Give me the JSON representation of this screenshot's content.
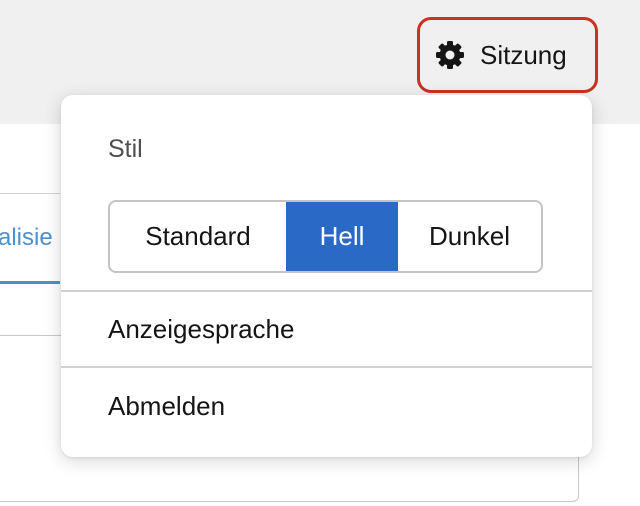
{
  "header": {
    "session_label": "Sitzung",
    "session_icon": "gear-icon"
  },
  "background": {
    "tab_text": "alisie"
  },
  "menu": {
    "style_heading": "Stil",
    "style_options": [
      "Standard",
      "Hell",
      "Dunkel"
    ],
    "selected_style": "Hell",
    "items": [
      {
        "label": "Anzeigesprache"
      },
      {
        "label": "Abmelden"
      }
    ]
  },
  "colors": {
    "highlight_border": "#c9331f",
    "selected_segment": "#2b69c7",
    "link_blue": "#4f8fcd",
    "topbar_bg": "#f0f0f0"
  }
}
